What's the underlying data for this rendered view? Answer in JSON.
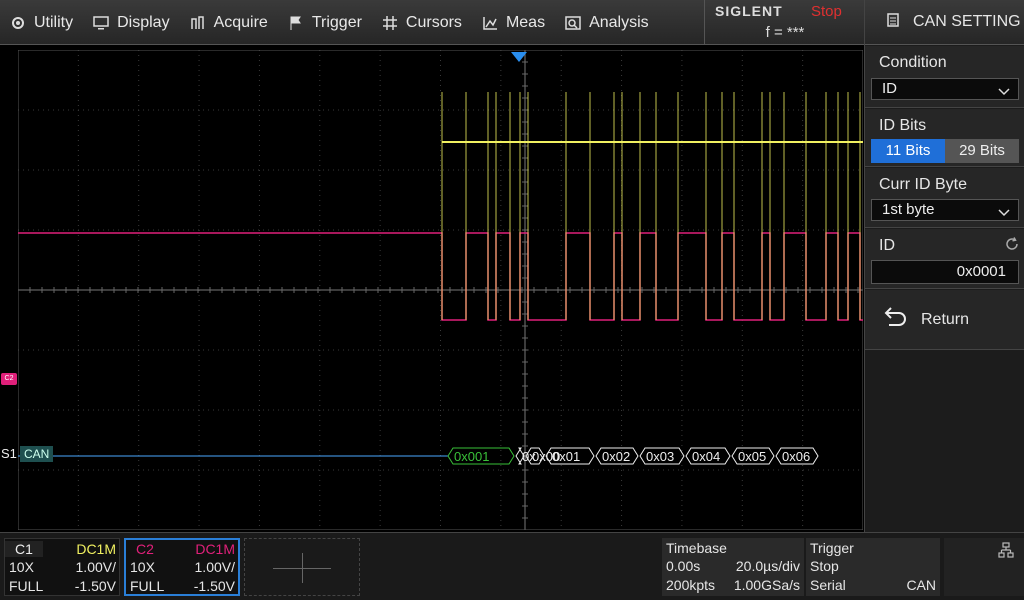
{
  "menu": {
    "utility": "Utility",
    "display": "Display",
    "acquire": "Acquire",
    "trigger": "Trigger",
    "cursors": "Cursors",
    "meas": "Meas",
    "analysis": "Analysis"
  },
  "brand": {
    "name": "SIGLENT",
    "status": "Stop",
    "frequency": "f = ***"
  },
  "panel": {
    "title": "CAN SETTING",
    "condition_label": "Condition",
    "condition_value": "ID",
    "id_bits_label": "ID Bits",
    "id_bits_options": [
      "11 Bits",
      "29 Bits"
    ],
    "id_bits_selected": "11 Bits",
    "curr_id_byte_label": "Curr ID Byte",
    "curr_id_byte_value": "1st byte",
    "id_label": "ID",
    "id_value": "0x0001",
    "return_label": "Return"
  },
  "waveform": {
    "c2_marker": "C2",
    "bus_label": "S1",
    "bus_protocol": "CAN",
    "frames": [
      "0x001",
      "0x",
      "0x00",
      "0x01",
      "0x02",
      "0x03",
      "0x04",
      "0x05",
      "0x06"
    ],
    "colors": {
      "ch1": "#f0f060",
      "ch2": "#e0207a",
      "bus": "#4aa8ff",
      "frame_first": "#39c039",
      "frame": "#eeeeee",
      "grid": "#3a3a3a"
    }
  },
  "channels": [
    {
      "name": "C1",
      "coupling": "DC1M",
      "probe": "10X",
      "scale": "1.00V/",
      "bandwidth": "FULL",
      "offset": "-1.50V"
    },
    {
      "name": "C2",
      "coupling": "DC1M",
      "probe": "10X",
      "scale": "1.00V/",
      "bandwidth": "FULL",
      "offset": "-1.50V"
    }
  ],
  "timebase": {
    "title": "Timebase",
    "delay": "0.00s",
    "scale": "20.0µs/div",
    "memory": "200kpts",
    "sample_rate": "1.00GSa/s"
  },
  "trigger_info": {
    "title": "Trigger",
    "state": "Stop",
    "type": "Serial",
    "source": "CAN"
  }
}
